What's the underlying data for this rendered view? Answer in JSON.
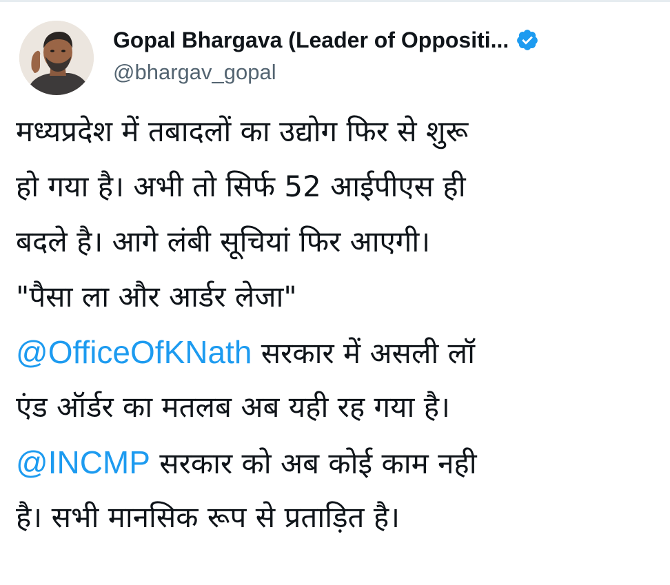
{
  "author": {
    "display_name": "Gopal Bhargava (Leader of Oppositi...",
    "handle": "@bhargav_gopal",
    "verified_icon": "verified-badge-icon"
  },
  "tweet": {
    "line1": "मध्यप्रदेश में तबादलों का उद्योग फिर से शुरू",
    "line2": "हो गया है। अभी तो सिर्फ 52 आईपीएस ही",
    "line3": "बदले है। आगे लंबी सूचियां फिर आएगी।",
    "line4": "\"पैसा ला और आर्डर लेजा\"",
    "mention1": "@OfficeOfKNath",
    "line5_rest": " सरकार में असली लॉ",
    "line6": "एंड ऑर्डर का मतलब अब यही रह गया है।",
    "mention2": "@INCMP",
    "line7_rest": " सरकार को अब कोई काम नही",
    "line8": "है। सभी मानसिक रूप से प्रताड़ित है।"
  },
  "colors": {
    "text": "#0f1419",
    "secondary": "#536471",
    "mention": "#1d9bf0",
    "verified": "#1d9bf0"
  }
}
